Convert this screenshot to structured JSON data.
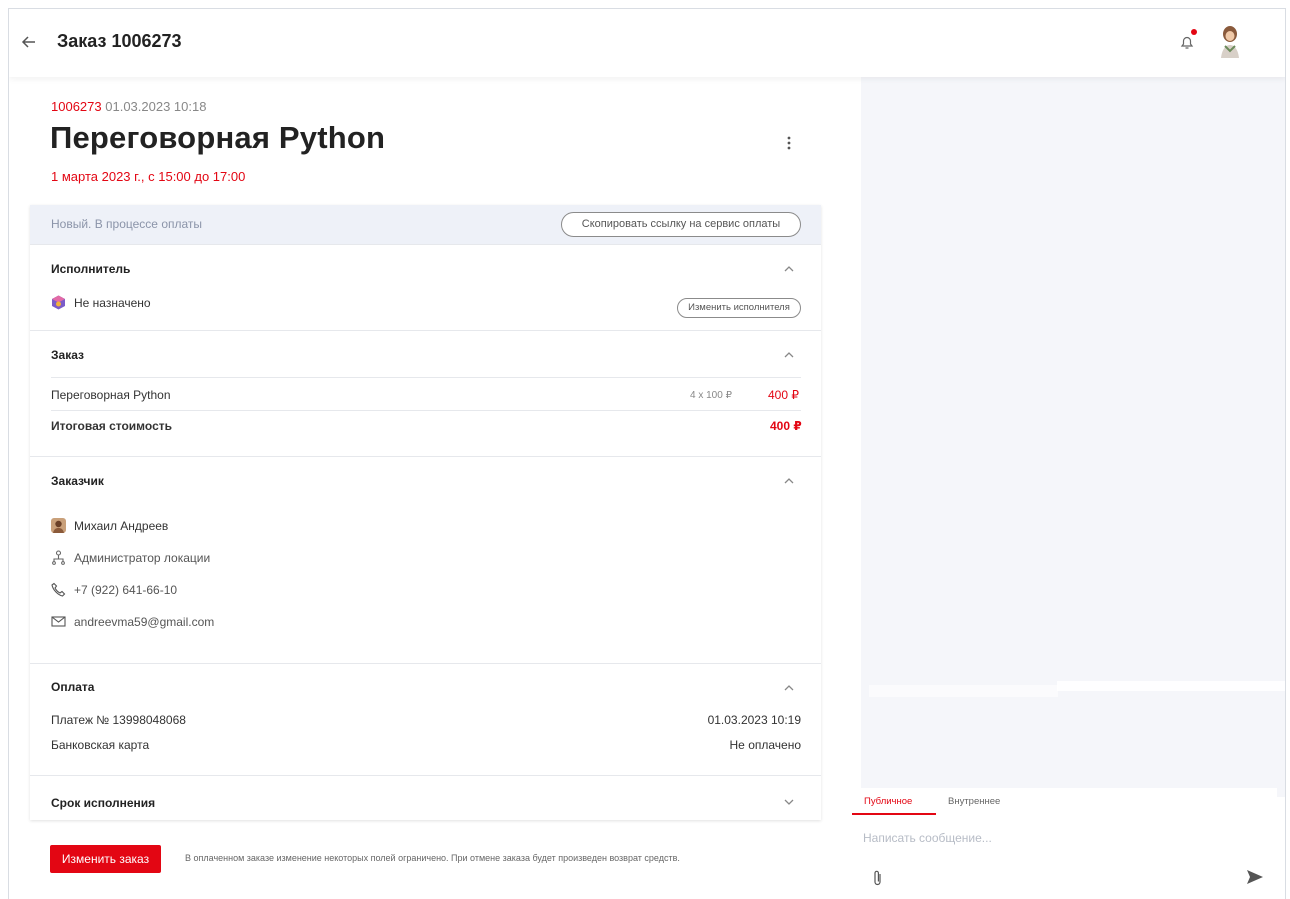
{
  "header": {
    "back_icon": "arrow-left-icon",
    "title": "Заказ 1006273",
    "notification_icon": "bell-icon",
    "notification_dot_color": "#e30613"
  },
  "order": {
    "number": "1006273",
    "created": "01.03.2023 10:18",
    "name": "Переговорная Python",
    "booking_time": "1 марта 2023 г., с 15:00 до 17:00",
    "menu_icon": "more-vertical-icon"
  },
  "status": {
    "text": "Новый. В процессе оплаты",
    "copy_button": "Скопировать ссылку на сервис оплаты"
  },
  "executor": {
    "title": "Исполнитель",
    "value": "Не назначено",
    "change_button": "Изменить исполнителя"
  },
  "order_section": {
    "title": "Заказ",
    "items": [
      {
        "name": "Переговорная Python",
        "qty_price": "4 x 100 ₽",
        "total": "400 ₽"
      }
    ],
    "total_label": "Итоговая стоимость",
    "total_value": "400 ₽"
  },
  "customer": {
    "title": "Заказчик",
    "name": "Михаил Андреев",
    "role": "Администратор локации",
    "phone": "+7 (922) 641-66-10",
    "email": "andreevma59@gmail.com"
  },
  "payment": {
    "title": "Оплата",
    "payment_number": "Платеж № 13998048068",
    "payment_date": "01.03.2023 10:19",
    "method": "Банковская карта",
    "status": "Не оплачено"
  },
  "deadline": {
    "title": "Срок исполнения"
  },
  "footer": {
    "edit_button": "Изменить заказ",
    "note": "В оплаченном заказе изменение некоторых полей ограничено. При отмене заказа будет произведен возврат средств."
  },
  "chat": {
    "tabs": [
      "Публичное",
      "Внутреннее"
    ],
    "active_tab": "Публичное",
    "placeholder": "Написать сообщение...",
    "attach_icon": "paperclip-icon",
    "send_icon": "send-icon"
  },
  "colors": {
    "accent": "#e30613",
    "status_bar": "#eef1f8",
    "chat_background": "#f5f6fa"
  }
}
